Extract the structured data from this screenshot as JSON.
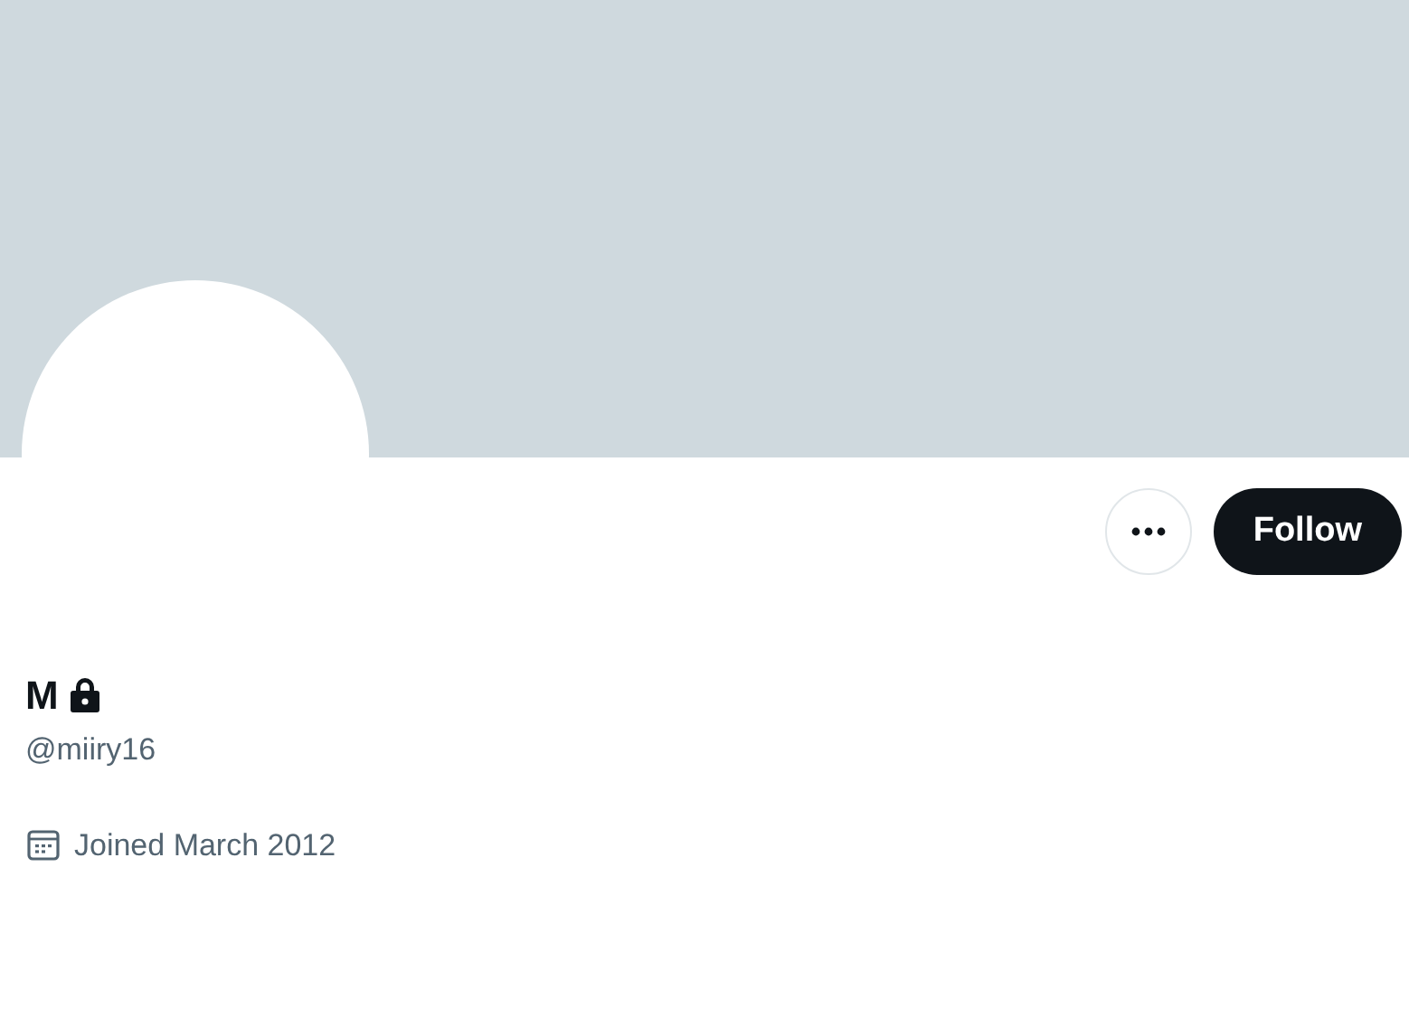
{
  "profile": {
    "name": "M",
    "protected": true,
    "handle": "@miiry16",
    "joined": "Joined March 2012"
  },
  "follow_button": {
    "label": "Follow"
  }
}
